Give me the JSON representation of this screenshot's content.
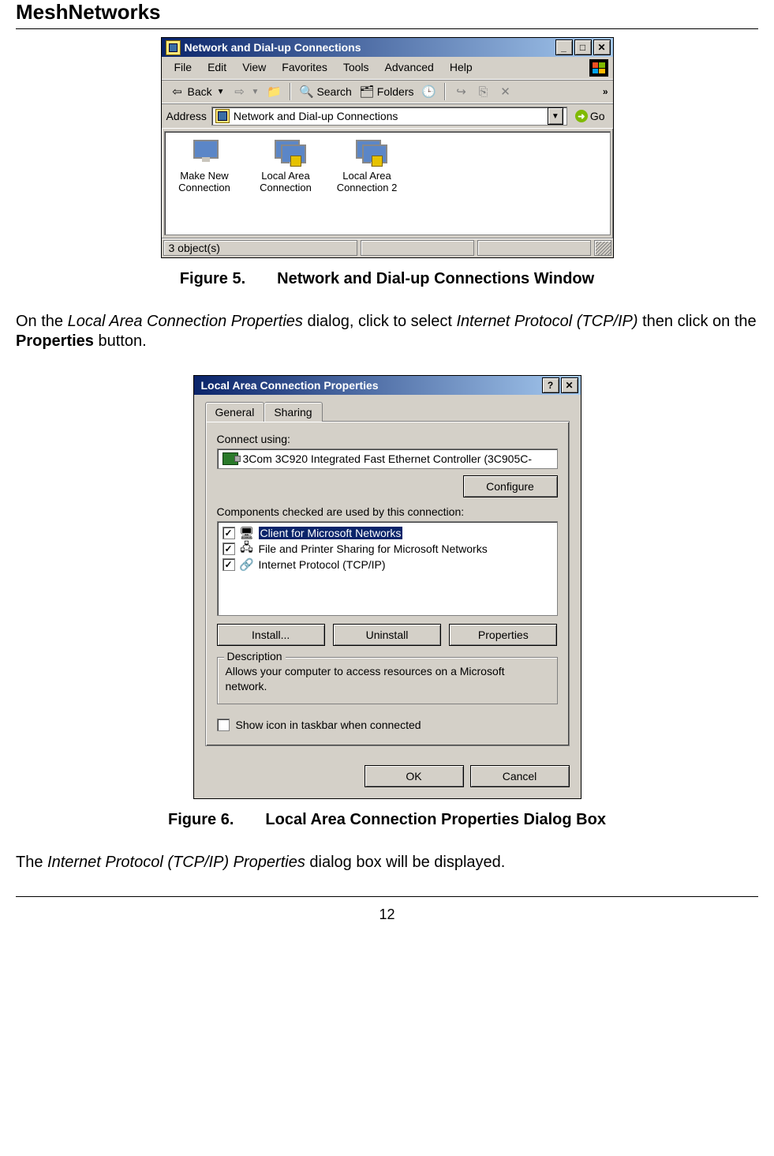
{
  "page": {
    "header": "MeshNetworks",
    "page_number": "12"
  },
  "figure5": {
    "caption_num": "Figure 5.",
    "caption_text": "Network and Dial-up Connections Window"
  },
  "figure6": {
    "caption_num": "Figure 6.",
    "caption_text": "Local Area Connection Properties Dialog Box"
  },
  "para1_a": "On the ",
  "para1_b": "Local Area Connection Properties",
  "para1_c": " dialog, click to select ",
  "para1_d": "Internet Protocol (TCP/IP)",
  "para1_e": " then click on the ",
  "para1_f": "Properties",
  "para1_g": " button.",
  "para2_a": "The ",
  "para2_b": "Internet Protocol (TCP/IP) Properties",
  "para2_c": " dialog box will be displayed.",
  "win1": {
    "title": "Network and Dial-up Connections",
    "menu": [
      "File",
      "Edit",
      "View",
      "Favorites",
      "Tools",
      "Advanced",
      "Help"
    ],
    "toolbar": {
      "back": "Back",
      "search": "Search",
      "folders": "Folders"
    },
    "address_label": "Address",
    "address_value": "Network and Dial-up Connections",
    "go": "Go",
    "items": [
      {
        "label": "Make New Connection"
      },
      {
        "label": "Local Area Connection"
      },
      {
        "label": "Local Area Connection 2"
      }
    ],
    "status": "3 object(s)"
  },
  "dlg": {
    "title": "Local Area Connection Properties",
    "tabs": [
      "General",
      "Sharing"
    ],
    "connect_using_label": "Connect using:",
    "adapter": "3Com 3C920 Integrated Fast Ethernet Controller (3C905C-",
    "configure_btn": "Configure",
    "components_label": "Components checked are used by this connection:",
    "components": [
      {
        "label": "Client for Microsoft Networks",
        "selected": true
      },
      {
        "label": "File and Printer Sharing for Microsoft Networks",
        "selected": false
      },
      {
        "label": "Internet Protocol (TCP/IP)",
        "selected": false
      }
    ],
    "install_btn": "Install...",
    "uninstall_btn": "Uninstall",
    "properties_btn": "Properties",
    "description_label": "Description",
    "description_text": "Allows your computer to access resources on a Microsoft network.",
    "show_icon_label": "Show icon in taskbar when connected",
    "ok": "OK",
    "cancel": "Cancel"
  }
}
